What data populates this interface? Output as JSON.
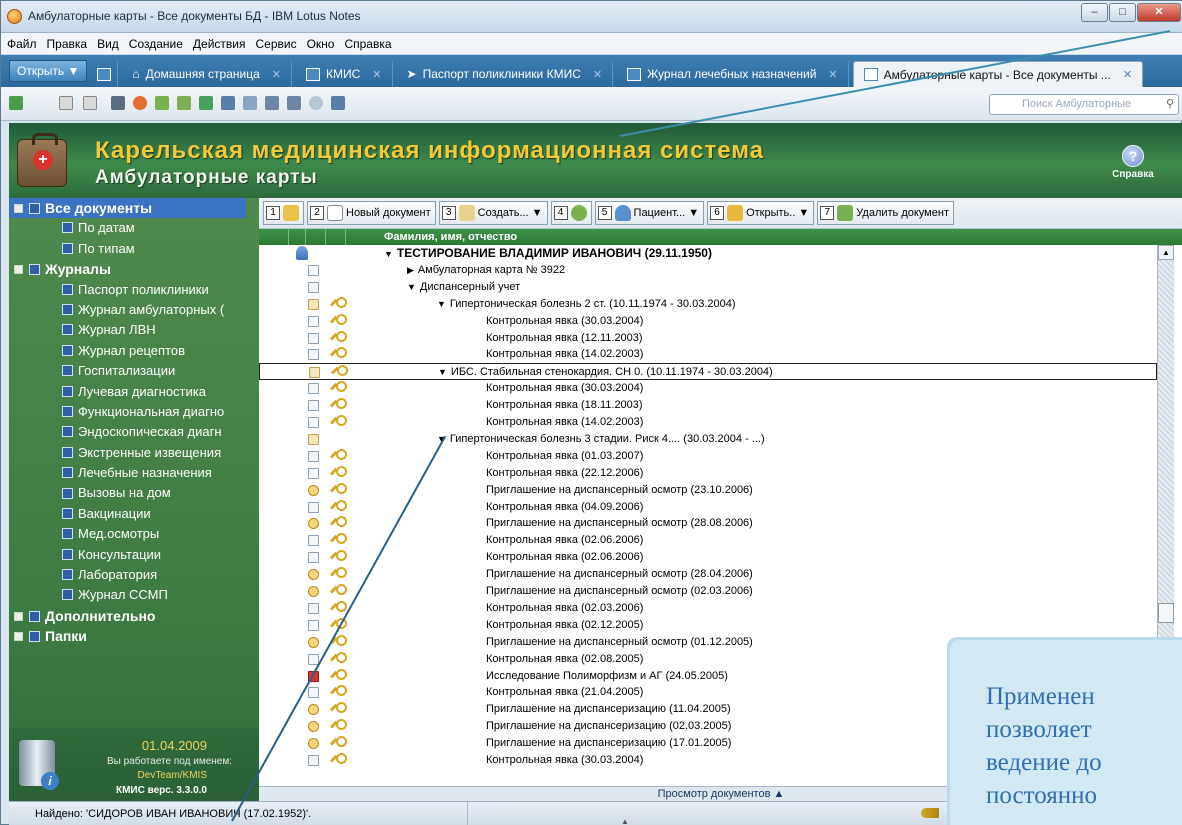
{
  "window": {
    "title": "Амбулаторные карты - Все документы БД - IBM Lotus Notes"
  },
  "menu": [
    "Файл",
    "Правка",
    "Вид",
    "Создание",
    "Действия",
    "Сервис",
    "Окно",
    "Справка"
  ],
  "tabs": {
    "open": "Открыть",
    "items": [
      {
        "label": "Домашняя страница",
        "icon": "home-icon"
      },
      {
        "label": "КМИС",
        "icon": "kmis-icon"
      },
      {
        "label": "Паспорт поликлиники КМИС",
        "icon": "arrow-icon"
      },
      {
        "label": "Журнал лечебных назначений",
        "icon": "grid-icon"
      },
      {
        "label": "Амбулаторные карты - Все документы ...",
        "icon": "doc-icon",
        "active": true
      }
    ]
  },
  "search": {
    "placeholder": "Поиск Амбулаторные"
  },
  "banner": {
    "title": "Карельская медицинская информационная система",
    "subtitle": "Амбулаторные карты",
    "help": "Справка"
  },
  "nav": {
    "top": [
      {
        "label": "Все документы",
        "selected": true,
        "children": [
          "По датам",
          "По типам"
        ]
      },
      {
        "label": "Журналы",
        "children": [
          "Паспорт поликлиники",
          "Журнал амбулаторных (",
          "Журнал ЛВН",
          "Журнал рецептов",
          "Госпитализации",
          "Лучевая диагностика",
          "Функциональная диагно",
          "Эндоскопическая диагн",
          "Экстренные извещения",
          "Лечебные назначения",
          "Вызовы на дом",
          "Вакцинации",
          "Мед.осмотры",
          "Консультации",
          "Лаборатория",
          "Журнал ССМП"
        ]
      },
      {
        "label": "Дополнительно",
        "children": []
      },
      {
        "label": "Папки",
        "children": []
      }
    ]
  },
  "sidebar_footer": {
    "date": "01.04.2009",
    "working_as": "Вы работаете под именем:",
    "user": "DevTeam/KMIS",
    "version": "КМИС верс. 3.3.0.0"
  },
  "actions": [
    {
      "num": "1",
      "label": ""
    },
    {
      "num": "2",
      "label": "Новый документ"
    },
    {
      "num": "3",
      "label": "Создать...",
      "dropdown": true
    },
    {
      "num": "4",
      "label": ""
    },
    {
      "num": "5",
      "label": "Пациент...",
      "dropdown": true
    },
    {
      "num": "6",
      "label": "Открыть..",
      "dropdown": true
    },
    {
      "num": "7",
      "label": "Удалить документ"
    }
  ],
  "column_header": "Фамилия, имя, отчество",
  "rows": [
    {
      "level": 0,
      "text": "ТЕСТИРОВАНИЕ ВЛАДИМИР ИВАНОВИЧ (29.11.1950)",
      "arrow": "▼",
      "icon": "person",
      "key": false
    },
    {
      "level": 1,
      "text": "Амбулаторная карта № 3922",
      "arrow": "▶",
      "icon": "doc",
      "key": false
    },
    {
      "level": 1,
      "text": "Диспансерный учет",
      "arrow": "▼",
      "icon": "doc",
      "key": false
    },
    {
      "level": 2,
      "text": "Гипертоническая болезнь 2 ст. (10.11.1974 - 30.03.2004)",
      "arrow": "▼",
      "icon": "pen",
      "key": true
    },
    {
      "level": 3,
      "text": "Контрольная явка (30.03.2004)",
      "icon": "doc",
      "key": true
    },
    {
      "level": 3,
      "text": "Контрольная явка (12.11.2003)",
      "icon": "doc",
      "key": true
    },
    {
      "level": 3,
      "text": "Контрольная явка (14.02.2003)",
      "icon": "doc",
      "key": true
    },
    {
      "level": 2,
      "text": "ИБС. Стабильная стенокардия. СН 0. (10.11.1974 - 30.03.2004)",
      "arrow": "▼",
      "icon": "pen",
      "key": true,
      "focus": true
    },
    {
      "level": 3,
      "text": "Контрольная явка (30.03.2004)",
      "icon": "doc",
      "key": true
    },
    {
      "level": 3,
      "text": "Контрольная явка (18.11.2003)",
      "icon": "doc",
      "key": true
    },
    {
      "level": 3,
      "text": "Контрольная явка (14.02.2003)",
      "icon": "doc",
      "key": true
    },
    {
      "level": 2,
      "text": "Гипертоническая болезнь 3 стадии. Риск 4.... (30.03.2004 - ...)",
      "arrow": "▼",
      "icon": "pen",
      "key": false
    },
    {
      "level": 3,
      "text": "Контрольная явка (01.03.2007)",
      "icon": "doc",
      "key": true
    },
    {
      "level": 3,
      "text": "Контрольная явка (22.12.2006)",
      "icon": "doc",
      "key": true
    },
    {
      "level": 3,
      "text": "Приглашение на диспансерный осмотр (23.10.2006)",
      "icon": "inv",
      "key": true
    },
    {
      "level": 3,
      "text": "Контрольная явка (04.09.2006)",
      "icon": "doc",
      "key": true
    },
    {
      "level": 3,
      "text": "Приглашение на диспансерный осмотр (28.08.2006)",
      "icon": "inv",
      "key": true
    },
    {
      "level": 3,
      "text": "Контрольная явка (02.06.2006)",
      "icon": "doc",
      "key": true
    },
    {
      "level": 3,
      "text": "Контрольная явка (02.06.2006)",
      "icon": "doc",
      "key": true
    },
    {
      "level": 3,
      "text": "Приглашение на диспансерный осмотр (28.04.2006)",
      "icon": "inv",
      "key": true
    },
    {
      "level": 3,
      "text": "Приглашение на диспансерный осмотр (02.03.2006)",
      "icon": "inv",
      "key": true
    },
    {
      "level": 3,
      "text": "Контрольная явка (02.03.2006)",
      "icon": "doc",
      "key": true
    },
    {
      "level": 3,
      "text": "Контрольная явка (02.12.2005)",
      "icon": "doc",
      "key": true
    },
    {
      "level": 3,
      "text": "Приглашение на диспансерный осмотр (01.12.2005)",
      "icon": "inv",
      "key": true
    },
    {
      "level": 3,
      "text": "Контрольная явка (02.08.2005)",
      "icon": "doc",
      "key": true
    },
    {
      "level": 3,
      "text": "Исследование Полиморфизм и АГ (24.05.2005)",
      "icon": "red",
      "key": true
    },
    {
      "level": 3,
      "text": "Контрольная явка (21.04.2005)",
      "icon": "doc",
      "key": true
    },
    {
      "level": 3,
      "text": "Приглашение на диспансеризацию (11.04.2005)",
      "icon": "inv",
      "key": true
    },
    {
      "level": 3,
      "text": "Приглашение на диспансеризацию (02.03.2005)",
      "icon": "inv",
      "key": true
    },
    {
      "level": 3,
      "text": "Приглашение на диспансеризацию (17.01.2005)",
      "icon": "inv",
      "key": true
    },
    {
      "level": 3,
      "text": "Контрольная явка (30.03.2004)",
      "icon": "doc",
      "key": true
    }
  ],
  "preview": "Просмотр документов ▲",
  "status": {
    "found": "Найдено: 'СИДОРОВ ИВАН ИВАНОВИЧ (17.02.1952)'."
  },
  "callout": {
    "lines": [
      "Применен",
      "позволяет",
      "ведение до",
      "постоянно"
    ]
  }
}
